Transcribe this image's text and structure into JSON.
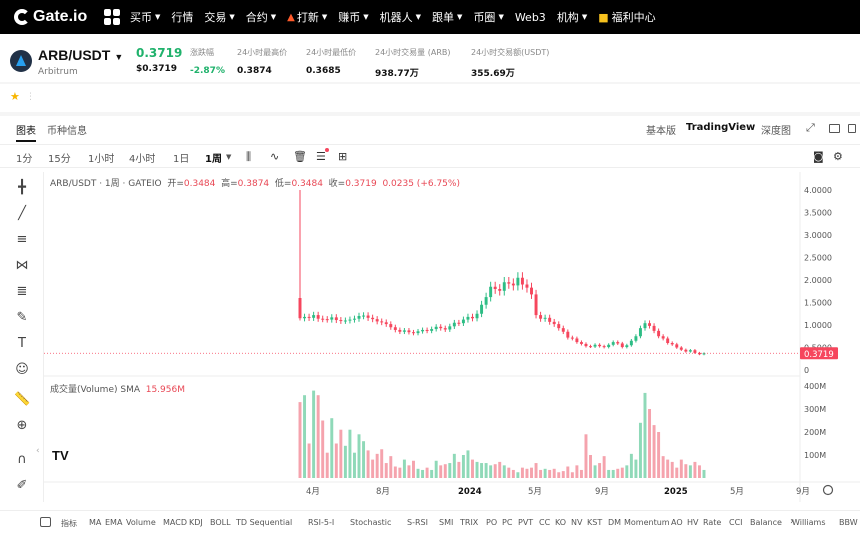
{
  "nav": {
    "logo": "Gate.io",
    "items": [
      {
        "label": "买币",
        "caret": true
      },
      {
        "label": "行情",
        "caret": false
      },
      {
        "label": "交易",
        "caret": true
      },
      {
        "label": "合约",
        "caret": true
      },
      {
        "label": "打新",
        "caret": true,
        "icon": "fire-icon"
      },
      {
        "label": "赚币",
        "caret": true
      },
      {
        "label": "机器人",
        "caret": true
      },
      {
        "label": "跟单",
        "caret": true
      },
      {
        "label": "币圈",
        "caret": true
      },
      {
        "label": "Web3",
        "caret": false
      },
      {
        "label": "机构",
        "caret": true
      },
      {
        "label": "福利中心",
        "caret": false,
        "icon": "gift-icon"
      }
    ]
  },
  "ticker": {
    "pair": "ARB/USDT",
    "name": "Arbitrum",
    "last_price": "0.3719",
    "last_price_usd": "$0.3719",
    "stats": [
      {
        "key": "涨跌幅",
        "value": "-2.87%"
      },
      {
        "key": "24小时最高价",
        "value": "0.3874"
      },
      {
        "key": "24小时最低价",
        "value": "0.3685"
      },
      {
        "key": "24小时交易量 (ARB)",
        "value": "938.77万"
      },
      {
        "key": "24小时交易额(USDT)",
        "value": "355.69万"
      }
    ]
  },
  "tabs": {
    "chart": "图表",
    "info": "币种信息",
    "basic": "基本版",
    "tradingview": "TradingView",
    "depth": "深度图"
  },
  "timeframes": [
    "1分",
    "15分",
    "1小时",
    "4小时",
    "1日",
    "1周"
  ],
  "legend": {
    "title": "ARB/USDT · 1周 · GATEIO",
    "open_label": "开=",
    "open": "0.3484",
    "high_label": "高=",
    "high": "0.3874",
    "low_label": "低=",
    "low": "0.3484",
    "close_label": "收=",
    "close": "0.3719",
    "change": "0.0235 (+6.75%)",
    "volume_label": "成交量(Volume) SMA",
    "volume_value": "15.956M"
  },
  "chart_data": {
    "type": "candlestick",
    "price_axis": [
      "4.0000",
      "3.5000",
      "3.0000",
      "2.5000",
      "2.0000",
      "1.5000",
      "1.0000",
      "0.5000",
      "0"
    ],
    "price_ylim": [
      0,
      4.0
    ],
    "current_price_label": "0.3719",
    "volume_axis": [
      "400M",
      "300M",
      "200M",
      "100M"
    ],
    "x_ticks": [
      "4月",
      "8月",
      "2024",
      "5月",
      "9月",
      "2025",
      "5月",
      "9月"
    ],
    "up_color": "#2ebd85",
    "down_color": "#f6465d",
    "weekly_closes": [
      1.15,
      1.18,
      1.16,
      1.22,
      1.14,
      1.13,
      1.12,
      1.17,
      1.11,
      1.09,
      1.1,
      1.12,
      1.14,
      1.2,
      1.21,
      1.16,
      1.13,
      1.08,
      1.06,
      1.02,
      0.95,
      0.89,
      0.85,
      0.88,
      0.84,
      0.82,
      0.86,
      0.89,
      0.87,
      0.91,
      0.96,
      0.93,
      0.9,
      0.97,
      1.05,
      1.04,
      1.12,
      1.18,
      1.15,
      1.25,
      1.45,
      1.62,
      1.85,
      1.8,
      1.76,
      1.95,
      1.92,
      1.88,
      2.05,
      1.9,
      1.83,
      1.68,
      1.22,
      1.14,
      1.16,
      1.07,
      1.02,
      0.93,
      0.85,
      0.72,
      0.7,
      0.62,
      0.58,
      0.53,
      0.52,
      0.56,
      0.53,
      0.51,
      0.56,
      0.62,
      0.59,
      0.51,
      0.55,
      0.65,
      0.75,
      0.93,
      1.04,
      0.98,
      0.87,
      0.75,
      0.7,
      0.6,
      0.57,
      0.5,
      0.45,
      0.41,
      0.44,
      0.38,
      0.35,
      0.37
    ],
    "weekly_volumes_m": [
      330,
      360,
      150,
      380,
      360,
      250,
      110,
      260,
      150,
      210,
      140,
      210,
      110,
      190,
      160,
      120,
      80,
      105,
      125,
      65,
      95,
      50,
      45,
      80,
      55,
      75,
      40,
      35,
      45,
      35,
      75,
      55,
      60,
      65,
      105,
      70,
      100,
      120,
      80,
      70,
      65,
      65,
      55,
      60,
      70,
      55,
      45,
      35,
      25,
      45,
      40,
      45,
      65,
      35,
      40,
      35,
      40,
      25,
      30,
      50,
      25,
      55,
      35,
      190,
      100,
      55,
      65,
      95,
      35,
      35,
      40,
      45,
      55,
      105,
      80,
      240,
      370,
      300,
      230,
      200,
      95,
      80,
      70,
      45,
      80,
      60,
      55,
      70,
      55,
      35
    ]
  },
  "indicators_label": "指标",
  "indicators": [
    "MA",
    "EMA",
    "Volume",
    "MACD",
    "KDJ",
    "BOLL",
    "TD Sequential",
    "RSI-5-I",
    "Stochastic",
    "S-RSI",
    "SMI",
    "TRIX",
    "PO",
    "PC",
    "PVT",
    "CC",
    "KO",
    "NV",
    "KST",
    "DM",
    "Momentum",
    "AO",
    "HV",
    "Rate",
    "CCI",
    "Balance",
    "Williams",
    "BBW",
    "ADI"
  ]
}
